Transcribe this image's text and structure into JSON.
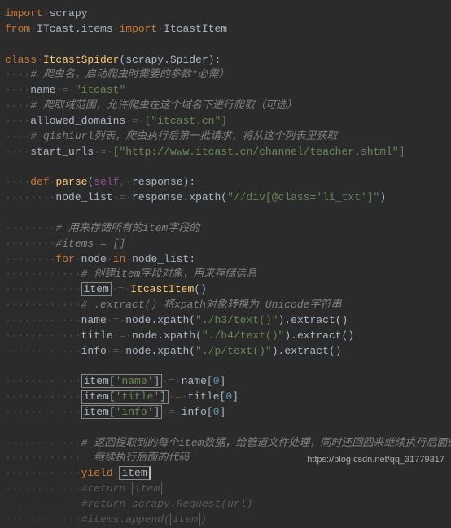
{
  "code": {
    "l1_import": "import",
    "l1_mod": "scrapy",
    "l2_from": "from",
    "l2_mod": "ITcast.items",
    "l2_import": "import",
    "l2_item": "ItcastItem",
    "l4_class": "class",
    "l4_name": "ItcastSpider",
    "l4_base": "scrapy.Spider",
    "l5_comment": "# 爬虫名，启动爬虫时需要的参数*必需）",
    "l6_var": "name",
    "l6_val": "\"itcast\"",
    "l7_comment": "# 爬取域范围，允许爬虫在这个域名下进行爬取（可选）",
    "l8_var": "allowed_domains",
    "l8_val": "[\"itcast.cn\"]",
    "l9_comment": "# qishiurl列表，爬虫执行后第一批请求，将从这个列表里获取",
    "l10_var": "start_urls",
    "l10_val": "[\"http://www.itcast.cn/channel/teacher.shtml\"]",
    "l12_def": "def",
    "l12_name": "parse",
    "l12_self": "self",
    "l12_param": "response",
    "l13_var": "node_list",
    "l13_expr_target": "response",
    "l13_method": "xpath",
    "l13_arg": "\"//div[@class='li_txt']\"",
    "l15_comment": "# 用来存储所有的item字段的",
    "l16_comment": "#items = []",
    "l17_for": "for",
    "l17_var": "node",
    "l17_in": "in",
    "l17_iter": "node_list",
    "l18_comment": "# 创建item字段对象，用来存储信息",
    "l19_var": "item",
    "l19_call": "ItcastItem",
    "l20_comment": "# .extract() 将xpath对象转换为 Unicode字符串",
    "l21_var": "name",
    "l21_target": "node",
    "l21_method": "xpath",
    "l21_arg": "\"./h3/text()\"",
    "l21_extract": "extract",
    "l22_var": "title",
    "l22_target": "node",
    "l22_method": "xpath",
    "l22_arg": "\"./h4/text()\"",
    "l22_extract": "extract",
    "l23_var": "info",
    "l23_target": "node",
    "l23_method": "xpath",
    "l23_arg": "\"./p/text()\"",
    "l23_extract": "extract",
    "l25_item": "item",
    "l25_key": "'name'",
    "l25_rhs": "name",
    "l25_idx": "0",
    "l26_item": "item",
    "l26_key": "'title'",
    "l26_rhs": "title",
    "l26_idx": "0",
    "l27_item": "item",
    "l27_key": "'info'",
    "l27_rhs": "info",
    "l27_idx": "0",
    "l29_comment": "# 返回提取到的每个item数据，给管道文件处理，同时还回回来继续执行后面的代码",
    "l29b_comment": "  继续执行后面的代码",
    "l30_yield": "yield",
    "l30_item": "item",
    "l31_comment": "#return ",
    "l31_boxed": "item",
    "l32_comment": "#return scrapy.Request(url)",
    "l33_comment": "#items.append(",
    "l33_boxed": "item",
    "l33_comment2": ")"
  },
  "watermark": "https://blog.csdn.net/qq_31779317",
  "dots4": "····",
  "dots8": "········",
  "dots12": "············",
  "eq": "·=·",
  "comma": ",·"
}
